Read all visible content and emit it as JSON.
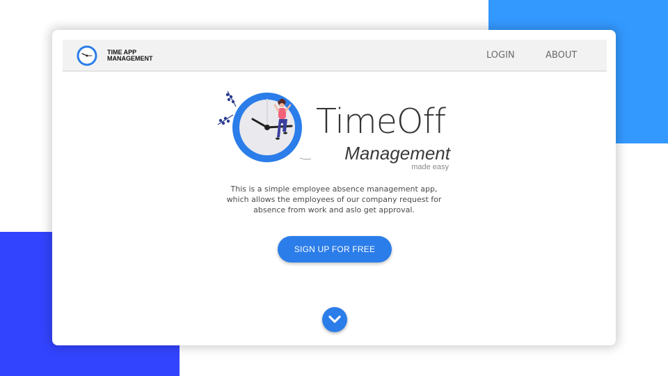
{
  "colors": {
    "accent_blue": "#2b7de9",
    "bg_block_top_right": "#3399ff",
    "bg_block_bottom_left": "#3344ff",
    "navbar_bg": "#f2f2f2"
  },
  "navbar": {
    "logo_icon": "clock-icon",
    "logo_line1": "TIME APP",
    "logo_line2": "MANAGEMENT",
    "links": [
      {
        "label": "LOGIN"
      },
      {
        "label": "ABOUT"
      }
    ]
  },
  "hero": {
    "illustration_icon": "clock-with-person-icon",
    "title": "TimeOff",
    "subtitle": "Management",
    "tagline": "made easy",
    "description_lines": [
      "This is a simple employee absence management app,",
      "which allows the employees of our company request for",
      "absence from work and aslo get approval."
    ],
    "cta_label": "SIGN UP FOR FREE",
    "scroll_icon": "chevron-down-icon"
  }
}
